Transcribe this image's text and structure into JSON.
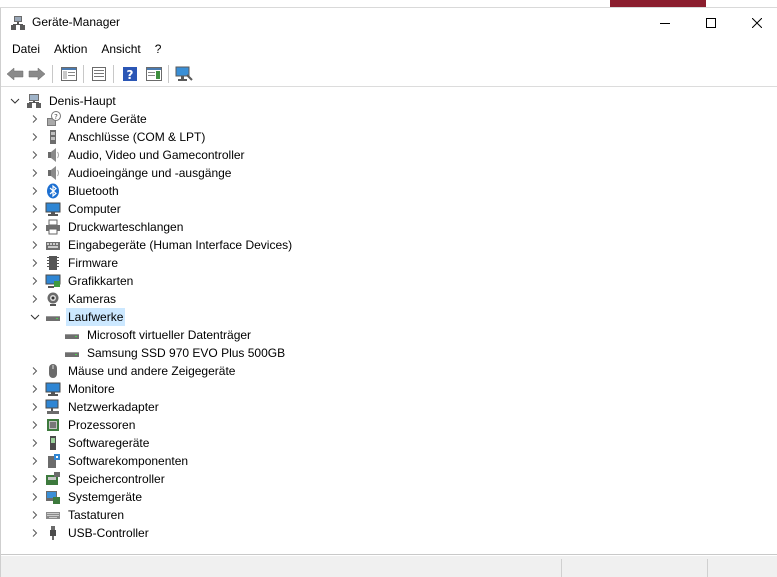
{
  "window": {
    "title": "Geräte-Manager"
  },
  "menu": [
    "Datei",
    "Aktion",
    "Ansicht",
    "?"
  ],
  "toolbar": [
    "back-icon",
    "forward-icon",
    "show-hide-console-tree-icon",
    "properties-icon",
    "help-icon",
    "show-action-pane-icon",
    "scan-hardware-icon"
  ],
  "tree": {
    "root": "Denis-Haupt",
    "items": [
      {
        "label": "Andere Geräte",
        "icon": "unknown-device-icon"
      },
      {
        "label": "Anschlüsse (COM & LPT)",
        "icon": "port-icon"
      },
      {
        "label": "Audio, Video und Gamecontroller",
        "icon": "speaker-icon"
      },
      {
        "label": "Audioeingänge und -ausgänge",
        "icon": "speaker-icon"
      },
      {
        "label": "Bluetooth",
        "icon": "bluetooth-icon"
      },
      {
        "label": "Computer",
        "icon": "computer-icon"
      },
      {
        "label": "Druckwarteschlangen",
        "icon": "printer-icon"
      },
      {
        "label": "Eingabegeräte (Human Interface Devices)",
        "icon": "hid-icon"
      },
      {
        "label": "Firmware",
        "icon": "firmware-icon"
      },
      {
        "label": "Grafikkarten",
        "icon": "display-adapter-icon"
      },
      {
        "label": "Kameras",
        "icon": "camera-icon"
      },
      {
        "label": "Laufwerke",
        "icon": "disk-drive-icon",
        "expanded": true,
        "selected": true,
        "children": [
          "Microsoft virtueller Datenträger",
          "Samsung SSD 970 EVO Plus 500GB"
        ]
      },
      {
        "label": "Mäuse und andere Zeigegeräte",
        "icon": "mouse-icon"
      },
      {
        "label": "Monitore",
        "icon": "monitor-icon"
      },
      {
        "label": "Netzwerkadapter",
        "icon": "network-adapter-icon"
      },
      {
        "label": "Prozessoren",
        "icon": "processor-icon"
      },
      {
        "label": "Softwaregeräte",
        "icon": "software-device-icon"
      },
      {
        "label": "Softwarekomponenten",
        "icon": "software-component-icon"
      },
      {
        "label": "Speichercontroller",
        "icon": "storage-controller-icon"
      },
      {
        "label": "Systemgeräte",
        "icon": "system-device-icon"
      },
      {
        "label": "Tastaturen",
        "icon": "keyboard-icon"
      },
      {
        "label": "USB-Controller",
        "icon": "usb-icon"
      }
    ]
  },
  "colors": {
    "selection": "#cce8ff",
    "accent": "#8b1e2e"
  }
}
